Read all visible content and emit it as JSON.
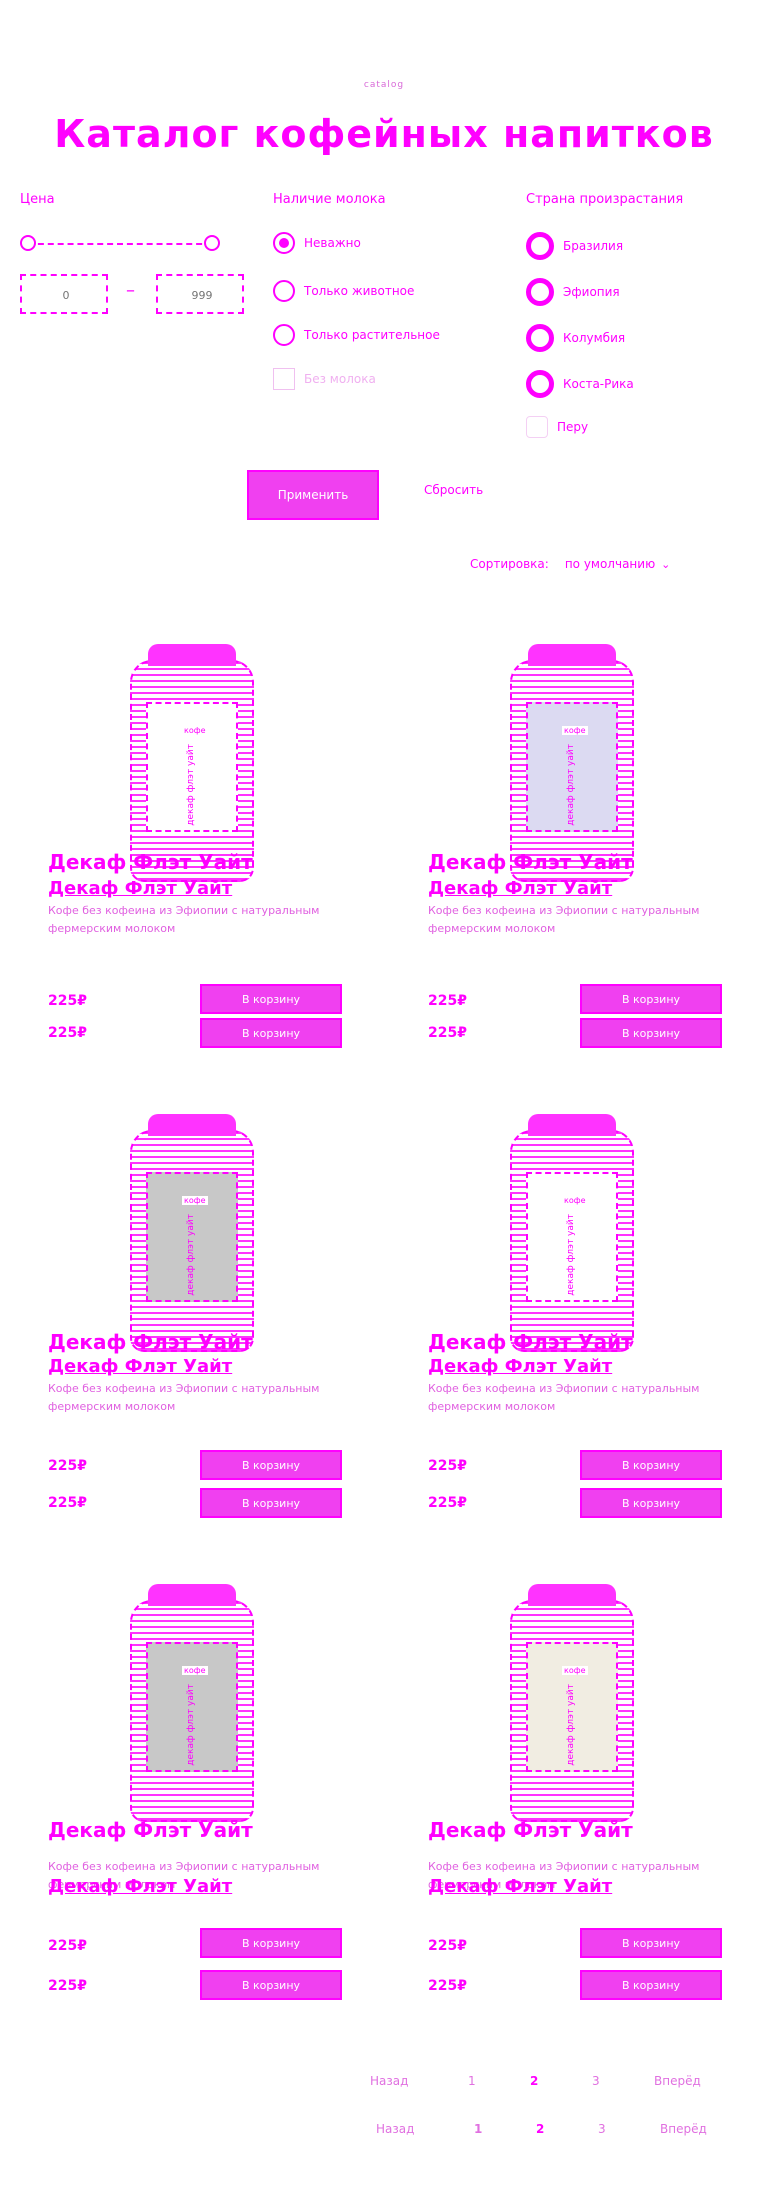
{
  "header": {
    "top_tag": "catalog",
    "title": "Каталог кофейных напитков"
  },
  "filters": {
    "price": {
      "label": "Цена",
      "min_placeholder": "0",
      "max_placeholder": "999"
    },
    "milk": {
      "label": "Наличие молока",
      "options": [
        {
          "label": "Неважно",
          "checked": true
        },
        {
          "label": "Только животное",
          "checked": false
        },
        {
          "label": "Только растительное",
          "checked": false
        },
        {
          "label": "Без молока",
          "checked": false
        }
      ]
    },
    "country": {
      "label": "Страна произрастания",
      "options": [
        {
          "label": "Бразилия"
        },
        {
          "label": "Эфиопия"
        },
        {
          "label": "Колумбия"
        },
        {
          "label": "Коста-Рика"
        },
        {
          "label": "Перу"
        }
      ]
    }
  },
  "actions": {
    "apply_label": "Применить",
    "reset_label": "Сбросить"
  },
  "sort": {
    "label": "Сортировка:",
    "value": "по умолчанию"
  },
  "products": [
    {
      "title": "Декаф Флэт Уайт",
      "title_repeat": "Декаф Флэт Уайт",
      "description": "Кофе без кофеина из Эфиопии с натуральным фермерским молоком",
      "price": "225₽",
      "buy_label": "В корзину",
      "can_word": "кофе",
      "can_text": "декаф флэт уайт"
    },
    {
      "title": "Декаф Флэт Уайт",
      "title_repeat": "Декаф Флэт Уайт",
      "description": "Кофе без кофеина из Эфиопии с натуральным фермерским молоком",
      "price": "225₽",
      "buy_label": "В корзину",
      "can_word": "кофе",
      "can_text": "декаф флэт уайт"
    },
    {
      "title": "Декаф Флэт Уайт",
      "title_repeat": "Декаф Флэт Уайт",
      "description": "Кофе без кофеина из Эфиопии с натуральным фермерским молоком",
      "price": "225₽",
      "buy_label": "В корзину",
      "can_word": "кофе",
      "can_text": "декаф флэт уайт"
    },
    {
      "title": "Декаф Флэт Уайт",
      "title_repeat": "Декаф Флэт Уайт",
      "description": "Кофе без кофеина из Эфиопии с натуральным фермерским молоком",
      "price": "225₽",
      "buy_label": "В корзину",
      "can_word": "кофе",
      "can_text": "декаф флэт уайт"
    },
    {
      "title": "Декаф Флэт Уайт",
      "title_repeat": "Декаф Флэт Уайт",
      "description": "Кофе без кофеина из Эфиопии с натуральным фермерским молоком",
      "price": "225₽",
      "buy_label": "В корзину",
      "can_word": "кофе",
      "can_text": "декаф флэт уайт"
    },
    {
      "title": "Декаф Флэт Уайт",
      "title_repeat": "Декаф Флэт Уайт",
      "description": "Кофе без кофеина из Эфиопии с натуральным фермерским молоком",
      "price": "225₽",
      "buy_label": "В корзину",
      "can_word": "кофе",
      "can_text": "декаф флэт уайт"
    }
  ],
  "pagination": {
    "prev": "Назад",
    "pages": [
      "1",
      "2",
      "3"
    ],
    "next": "Вперёд"
  },
  "colors": {
    "accent": "#ff00ff",
    "button_fill": "#f040f0",
    "background": "#ffffff"
  }
}
